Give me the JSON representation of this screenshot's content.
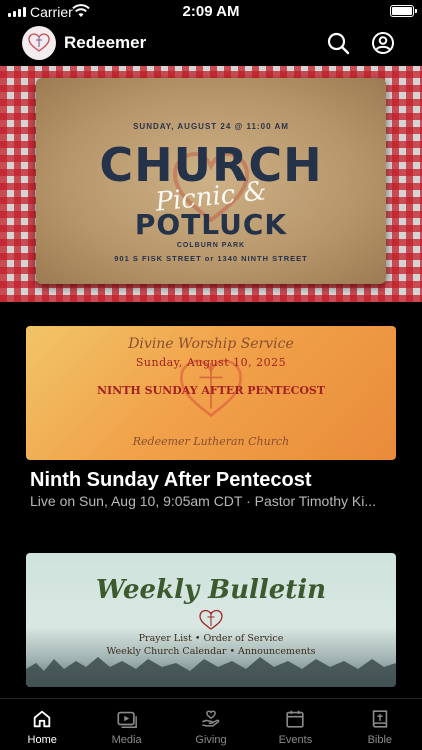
{
  "status_bar": {
    "carrier": "Carrier",
    "time": "2:09 AM"
  },
  "header": {
    "title": "Redeemer",
    "icons": [
      "search-icon",
      "profile-icon"
    ]
  },
  "hero": {
    "date": "SUNDAY, AUGUST 24 @ 11:00 AM",
    "line1": "CHURCH",
    "line2": "Picnic &",
    "line3": "POTLUCK",
    "park": "COLBURN PARK",
    "address": "901 S FISK STREET or 1340 NINTH STREET",
    "page_count": 4,
    "active_page": 1
  },
  "cards": [
    {
      "image": {
        "title": "Divine Worship Service",
        "date": "Sunday, August 10, 2025",
        "subtitle": "NINTH SUNDAY AFTER PENTECOST",
        "church": "Redeemer Lutheran Church"
      },
      "title": "Ninth Sunday After Pentecost",
      "subtitle": "Live on Sun, Aug 10, 9:05am CDT · Pastor Timothy Ki..."
    },
    {
      "image": {
        "title": "Weekly Bulletin",
        "line1": "Prayer List • Order of Service",
        "line2": "Weekly Church Calendar • Announcements"
      }
    }
  ],
  "tabs": [
    {
      "label": "Home",
      "icon": "home-icon",
      "active": true
    },
    {
      "label": "Media",
      "icon": "media-icon",
      "active": false
    },
    {
      "label": "Giving",
      "icon": "giving-icon",
      "active": false
    },
    {
      "label": "Events",
      "icon": "calendar-icon",
      "active": false
    },
    {
      "label": "Bible",
      "icon": "bible-icon",
      "active": false
    }
  ],
  "colors": {
    "background": "#000000",
    "checker_red": "#c31e28",
    "text_secondary": "#b8b8b8",
    "tab_inactive": "#8a8a8a"
  }
}
